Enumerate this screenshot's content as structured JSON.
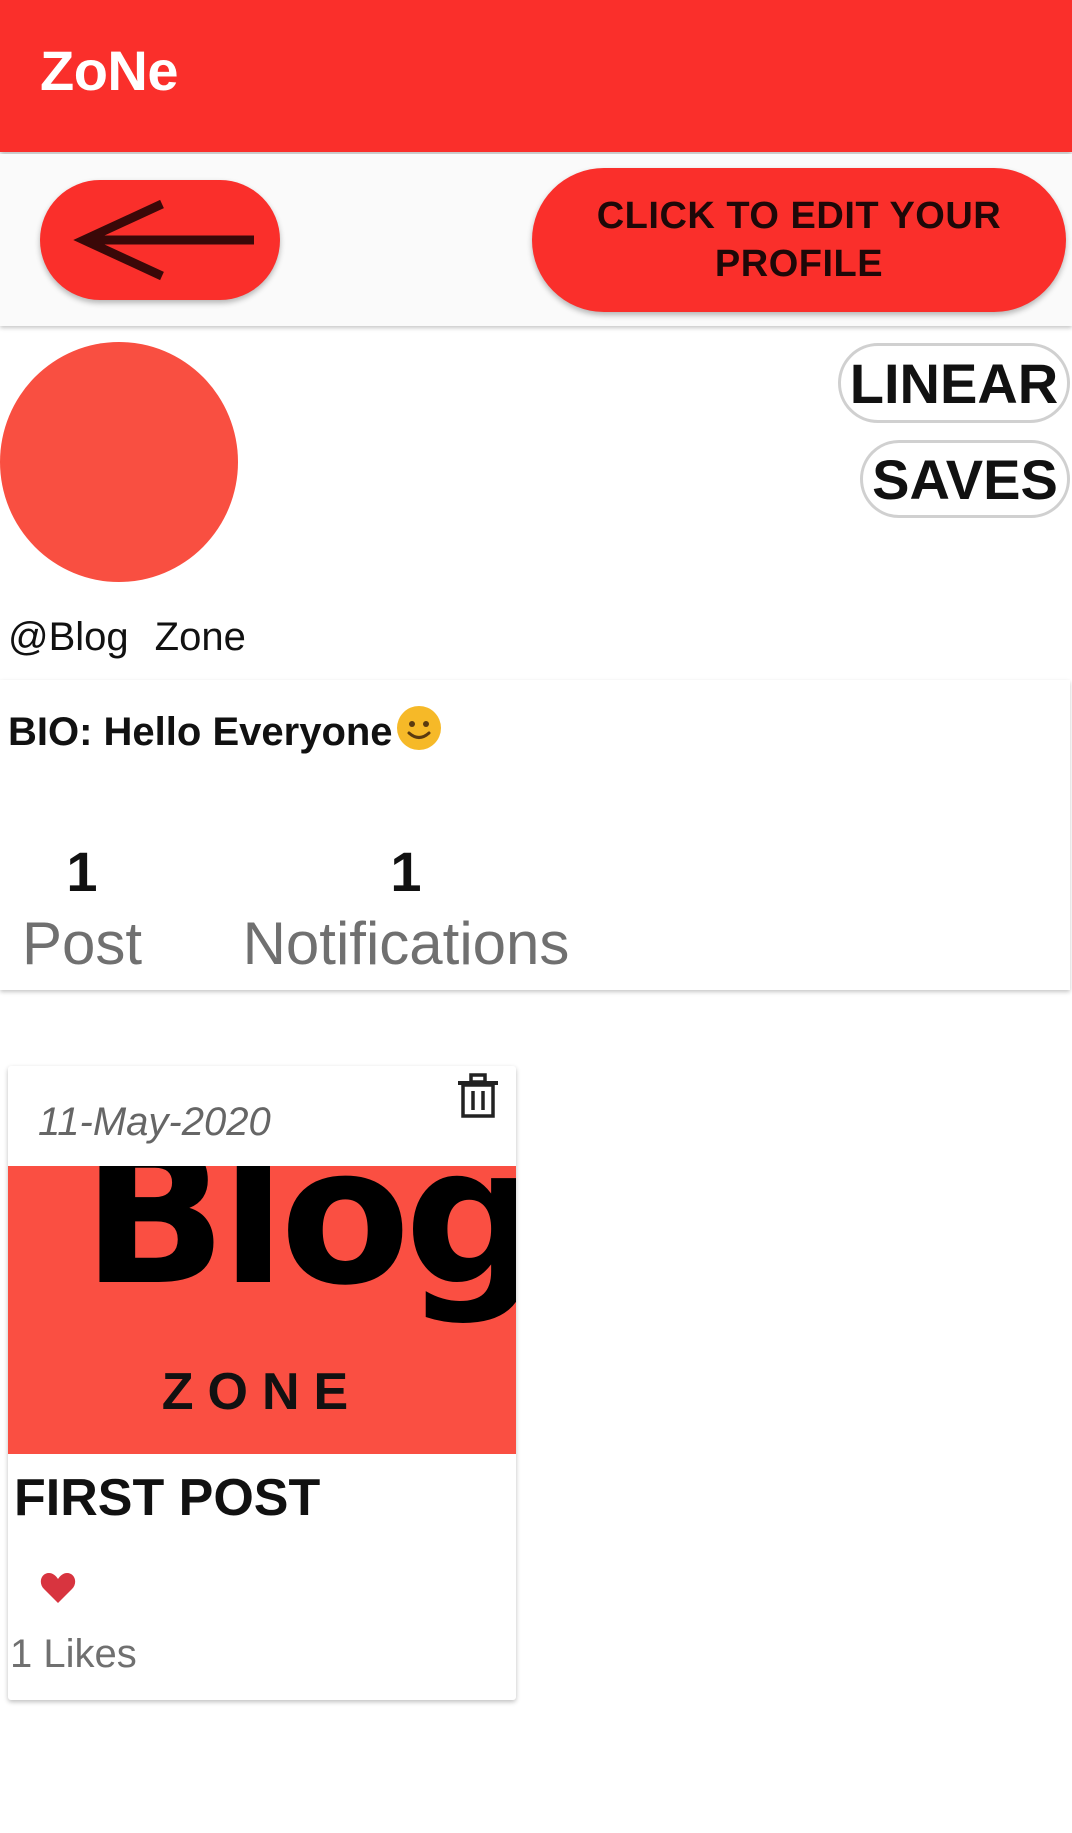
{
  "app": {
    "title": "ZoNe"
  },
  "toolbar": {
    "edit_profile_label": "CLICK TO EDIT YOUR PROFILE"
  },
  "profile": {
    "username_handle": "@Blog",
    "username_name": "Zone",
    "bio": "BIO: Hello Everyone",
    "bio_emoji": "🙂",
    "linear_label": "LINEAR",
    "saves_label": "SAVES"
  },
  "stats": {
    "posts": {
      "value": "1",
      "label": "Post"
    },
    "notifications": {
      "value": "1",
      "label": "Notifications"
    }
  },
  "posts": [
    {
      "date": "11-May-2020",
      "image_text_main": "Blog",
      "image_text_sub": "ZONE",
      "title": "FIRST POST",
      "likes": "1 Likes"
    }
  ],
  "colors": {
    "accent": "#fa2f2b",
    "avatar": "#f94f41",
    "heart": "#d8343f"
  },
  "icons": {
    "back": "arrow-left-icon",
    "delete": "trash-icon",
    "like": "heart-icon"
  }
}
